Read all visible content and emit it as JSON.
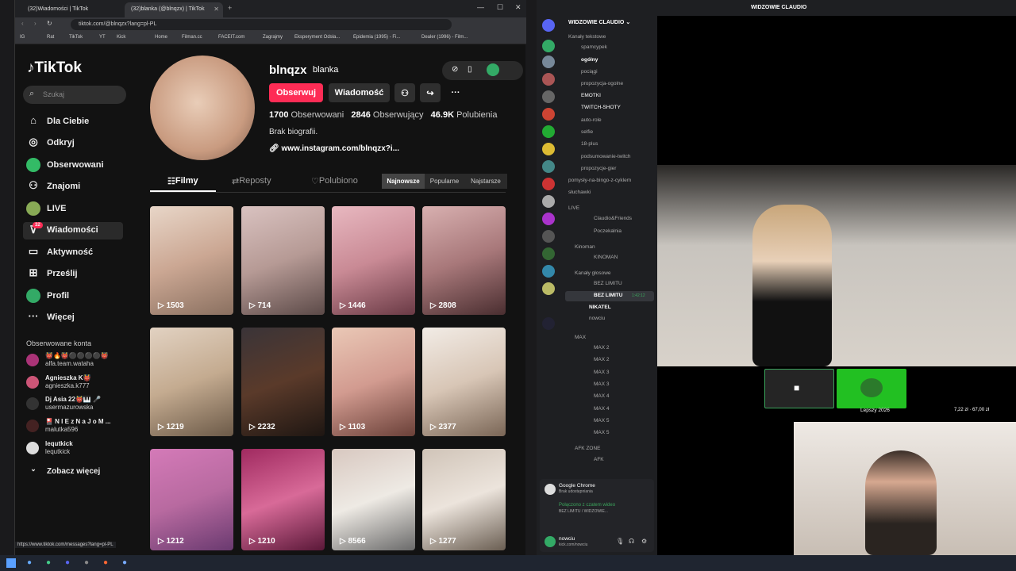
{
  "browser": {
    "tabs": [
      {
        "label": "(32)Wiadomości | TikTok"
      },
      {
        "label": "(32)blanka (@blnqzx) | TikTok"
      }
    ],
    "address": "tiktok.com/@blnqzx?lang=pl-PL",
    "bookmarks": [
      "IG",
      "Rat",
      "TikTok",
      "YT",
      "Kick",
      "Home",
      "Filman.cc",
      "FACEIT.com",
      "Zagrajmy",
      "Eksperyment Odsła...",
      "Epidemia (1995) - Fi...",
      "Dealer (1996) - Film..."
    ],
    "status_url": "https://www.tiktok.com/messages?lang=pl-PL"
  },
  "tiktok": {
    "logo": "TikTok",
    "search_placeholder": "Szukaj",
    "nav": [
      "Dla Ciebie",
      "Odkryj",
      "Obserwowani",
      "Znajomi",
      "LIVE",
      "Wiadomości",
      "Aktywność",
      "Prześlij",
      "Profil",
      "Więcej"
    ],
    "messages_badge": "32",
    "followed_header": "Obserwowane konta",
    "followed": [
      {
        "name": "👹🔥👹⚫⚫⚫⚫👹",
        "handle": "alfa.team.wataha"
      },
      {
        "name": "Agnieszka K👹",
        "handle": "agnieszka.k777"
      },
      {
        "name": "Dj Asia 22👹🎹 🎤",
        "handle": "usermazurowska"
      },
      {
        "name": "🎴 N I E z N a J o M ...",
        "handle": "malutka596"
      },
      {
        "name": "lequtkick",
        "handle": "lequtkick"
      }
    ],
    "see_more": "Zobacz więcej"
  },
  "profile": {
    "username": "blnqzx",
    "nickname": "blanka",
    "follow": "Obserwuj",
    "message": "Wiadomość",
    "following_count": "1700",
    "following_label": "Obserwowani",
    "followers_count": "2846",
    "followers_label": "Obserwujący",
    "likes_count": "46.9K",
    "likes_label": "Polubienia",
    "bio": "Brak biografii.",
    "link": "www.instagram.com/blnqzx?i...",
    "tabs": [
      "Filmy",
      "Reposty",
      "Polubiono"
    ],
    "sort": [
      "Najnowsze",
      "Popularne",
      "Najstarsze"
    ],
    "videos": [
      "1503",
      "714",
      "1446",
      "2808",
      "1219",
      "2232",
      "1103",
      "2377",
      "1212",
      "1210",
      "8566",
      "1277"
    ]
  },
  "discord": {
    "server": "WIDZOWIE CLAUDIO",
    "title": "WIDZOWIE CLAUDIO",
    "channels": [
      "Kanały tekstowe",
      "spamcypek",
      "ogólny",
      "pociągi",
      "propozycja-ogolne",
      "EMOTKI",
      "TWITCH-SHOTY",
      "auto-role",
      "selfie",
      "18-plus",
      "podsumowanie-twitch",
      "propozycje-gier",
      "pomysły-na-bingo-z-cyklem",
      "słuchawki",
      "LIVE",
      "Claudio&Friends",
      "Poczekalnia",
      "Kinoman",
      "KINOMAN",
      "Kanały głosowe",
      "BEZ LIMITU",
      "BEZ LIMITU",
      "NIKATEL",
      "nowciu",
      "MAX",
      "MAX 2",
      "MAX 2",
      "MAX 3",
      "MAX 3",
      "MAX 4",
      "MAX 4",
      "MAX 5",
      "MAX 5",
      "AFK ZONE",
      "AFK"
    ],
    "activity_title": "Google Chrome",
    "activity_sub": "Brak udostępniania",
    "connected": "Połączono z czatem wideo",
    "connected_sub": "BEZ LIMITU / WIDZOWIE...",
    "user": "nowciu",
    "user_status": "kick.com/nowciu",
    "voice_time": "1:42:12",
    "stream_label": "Lepszy 2026",
    "money": "7,22 zł · 67,00 zł"
  }
}
